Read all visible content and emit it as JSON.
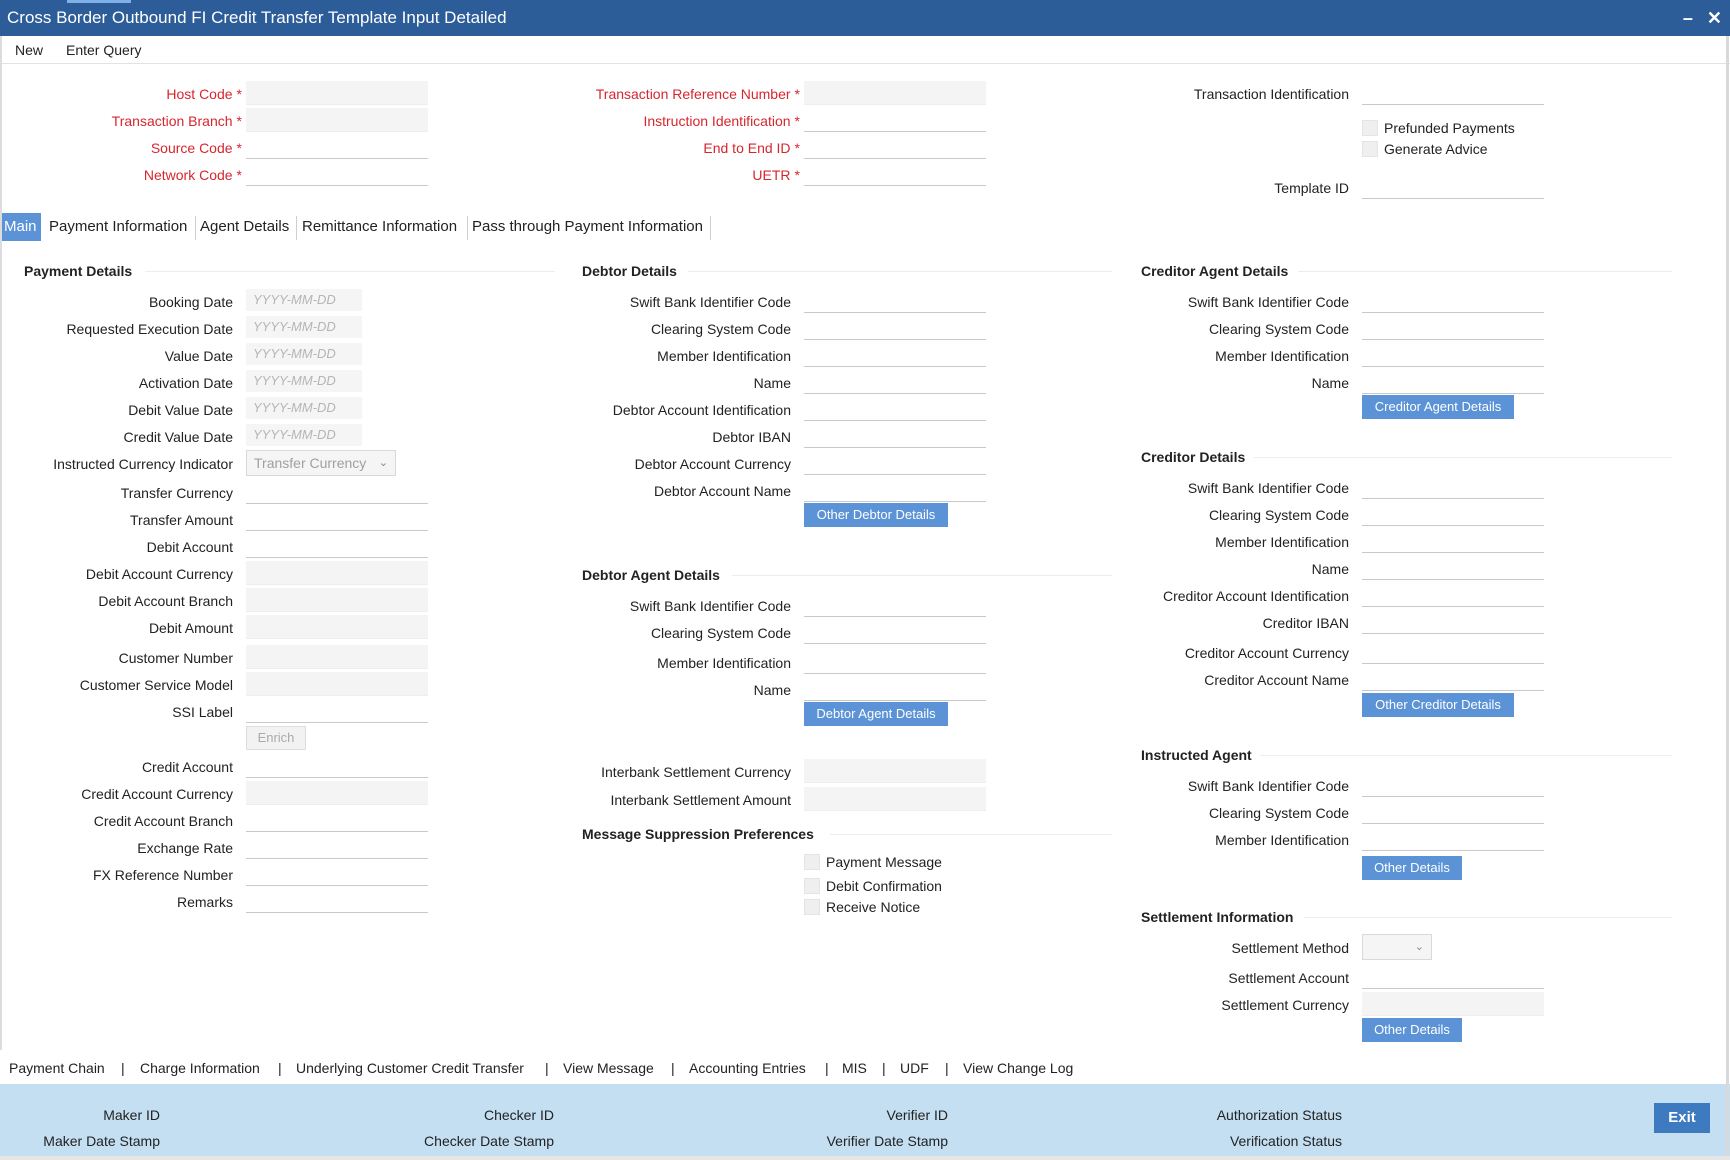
{
  "window": {
    "title": "Cross Border Outbound FI Credit Transfer Template Input Detailed",
    "minimize_icon": "minimize-icon",
    "close_icon": "close-icon"
  },
  "menu": {
    "new": "New",
    "enter_query": "Enter Query"
  },
  "header": {
    "host_code": "Host Code",
    "transaction_branch": "Transaction Branch",
    "source_code": "Source Code",
    "network_code": "Network Code",
    "transaction_reference_number": "Transaction Reference Number",
    "instruction_identification": "Instruction Identification",
    "end_to_end_id": "End to End ID",
    "uetr": "UETR",
    "transaction_identification": "Transaction Identification",
    "prefunded_payments": "Prefunded Payments",
    "generate_advice": "Generate Advice",
    "template_id": "Template ID",
    "required_mark": "*"
  },
  "tabs": [
    "Main",
    "Payment Information",
    "Agent Details",
    "Remittance Information",
    "Pass through Payment Information"
  ],
  "payment_details": {
    "title": "Payment Details",
    "booking_date": "Booking Date",
    "requested_execution_date": "Requested Execution Date",
    "value_date": "Value Date",
    "activation_date": "Activation Date",
    "debit_value_date": "Debit Value Date",
    "credit_value_date": "Credit Value Date",
    "date_placeholder": "YYYY-MM-DD",
    "instructed_currency_indicator": "Instructed Currency Indicator",
    "instructed_currency_value": "Transfer Currency",
    "transfer_currency": "Transfer Currency",
    "transfer_amount": "Transfer Amount",
    "debit_account": "Debit Account",
    "debit_account_currency": "Debit Account Currency",
    "debit_account_branch": "Debit Account Branch",
    "debit_amount": "Debit Amount",
    "customer_number": "Customer Number",
    "customer_service_model": "Customer Service Model",
    "ssi_label": "SSI Label",
    "enrich": "Enrich",
    "credit_account": "Credit Account",
    "credit_account_currency": "Credit Account Currency",
    "credit_account_branch": "Credit Account Branch",
    "exchange_rate": "Exchange Rate",
    "fx_reference_number": "FX Reference Number",
    "remarks": "Remarks"
  },
  "debtor_details": {
    "title": "Debtor Details",
    "swift_bic": "Swift Bank Identifier Code",
    "clearing_system_code": "Clearing System Code",
    "member_identification": "Member Identification",
    "name": "Name",
    "debtor_account_identification": "Debtor Account Identification",
    "debtor_iban": "Debtor IBAN",
    "debtor_account_currency": "Debtor Account Currency",
    "debtor_account_name": "Debtor Account Name",
    "other_button": "Other Debtor Details"
  },
  "debtor_agent_details": {
    "title": "Debtor Agent Details",
    "swift_bic": "Swift Bank Identifier Code",
    "clearing_system_code": "Clearing System Code",
    "member_identification": "Member Identification",
    "name": "Name",
    "button": "Debtor Agent Details",
    "interbank_settlement_currency": "Interbank Settlement Currency",
    "interbank_settlement_amount": "Interbank Settlement Amount"
  },
  "message_suppression": {
    "title": "Message Suppression Preferences",
    "payment_message": "Payment Message",
    "debit_confirmation": "Debit Confirmation",
    "receive_notice": "Receive Notice"
  },
  "creditor_agent_details": {
    "title": "Creditor Agent Details",
    "swift_bic": "Swift Bank Identifier Code",
    "clearing_system_code": "Clearing System Code",
    "member_identification": "Member Identification",
    "name": "Name",
    "button": "Creditor Agent Details"
  },
  "creditor_details": {
    "title": "Creditor Details",
    "swift_bic": "Swift Bank Identifier Code",
    "clearing_system_code": "Clearing System Code",
    "member_identification": "Member Identification",
    "name": "Name",
    "creditor_account_identification": "Creditor Account Identification",
    "creditor_iban": "Creditor IBAN",
    "creditor_account_currency": "Creditor Account Currency",
    "creditor_account_name": "Creditor Account Name",
    "other_button": "Other Creditor Details"
  },
  "instructed_agent": {
    "title": "Instructed Agent",
    "swift_bic": "Swift Bank Identifier Code",
    "clearing_system_code": "Clearing System Code",
    "member_identification": "Member Identification",
    "other_button": "Other Details"
  },
  "settlement_information": {
    "title": "Settlement Information",
    "settlement_method": "Settlement Method",
    "settlement_account": "Settlement Account",
    "settlement_currency": "Settlement Currency",
    "other_button": "Other Details"
  },
  "footer_links": [
    "Payment Chain",
    "Charge Information",
    "Underlying Customer Credit Transfer",
    "View Message",
    "Accounting Entries",
    "MIS",
    "UDF",
    "View Change Log"
  ],
  "footer_separator": "|",
  "status_bar": {
    "maker_id": "Maker ID",
    "maker_date_stamp": "Maker Date Stamp",
    "checker_id": "Checker ID",
    "checker_date_stamp": "Checker Date Stamp",
    "verifier_id": "Verifier ID",
    "verifier_date_stamp": "Verifier Date Stamp",
    "authorization_status": "Authorization Status",
    "verification_status": "Verification Status",
    "exit": "Exit"
  },
  "colors": {
    "title_bar": "#2c5d99",
    "accent_button": "#5b93d6",
    "required_label": "#d7262e",
    "status_bar": "#c5dff2",
    "exit_button": "#3e7ac0"
  }
}
